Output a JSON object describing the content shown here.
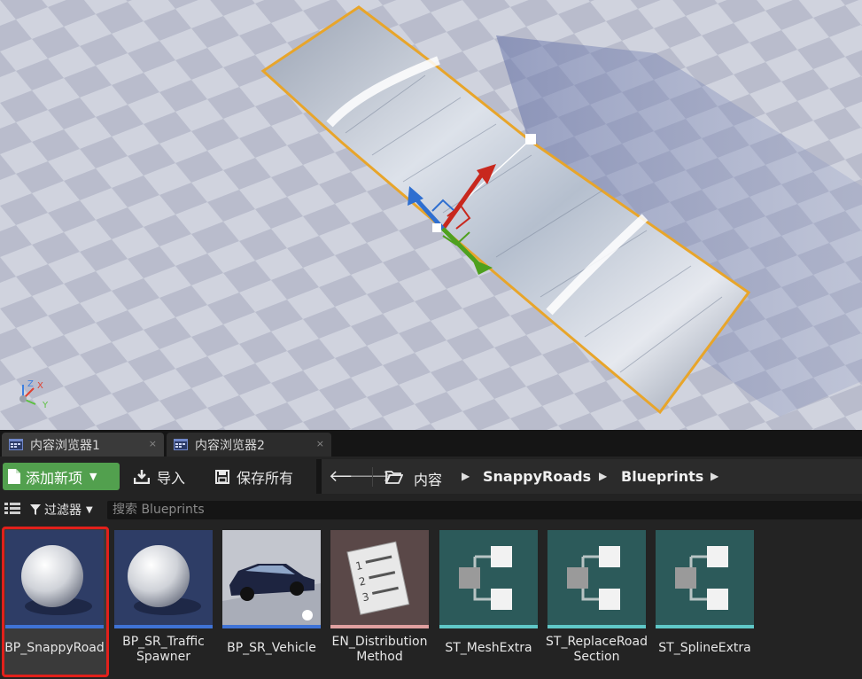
{
  "viewport": {
    "axis_x_label": "X",
    "axis_y_label": "Y",
    "axis_z_label": "Z"
  },
  "tabs": [
    {
      "label": "内容浏览器1",
      "active": true,
      "close": "×"
    },
    {
      "label": "内容浏览器2",
      "active": false,
      "close": "×"
    }
  ],
  "toolbar": {
    "add_new_label": "添加新项",
    "import_label": "导入",
    "save_all_label": "保存所有",
    "add_color": "#52a04e"
  },
  "breadcrumb": {
    "root": "内容",
    "items": [
      "SnappyRoads",
      "Blueprints"
    ]
  },
  "filter": {
    "label": "过滤器",
    "search_placeholder": "搜索 Blueprints"
  },
  "assets": [
    {
      "name": "BP_SnappyRoad",
      "type": "blueprint-sphere",
      "selected": true,
      "bar_color": "#3f73d6"
    },
    {
      "name": "BP_SR_Traffic\nSpawner",
      "type": "blueprint-sphere",
      "selected": false,
      "bar_color": "#3f73d6"
    },
    {
      "name": "BP_SR_Vehicle",
      "type": "blueprint-car",
      "selected": false,
      "bar_color": "#3f73d6"
    },
    {
      "name": "EN_Distribution\nMethod",
      "type": "enum",
      "selected": false,
      "bar_color": "#e0a0a0"
    },
    {
      "name": "ST_MeshExtra",
      "type": "struct",
      "selected": false,
      "bar_color": "#5fc8c8"
    },
    {
      "name": "ST_ReplaceRoad\nSection",
      "type": "struct",
      "selected": false,
      "bar_color": "#5fc8c8"
    },
    {
      "name": "ST_SplineExtra",
      "type": "struct",
      "selected": false,
      "bar_color": "#5fc8c8"
    }
  ]
}
